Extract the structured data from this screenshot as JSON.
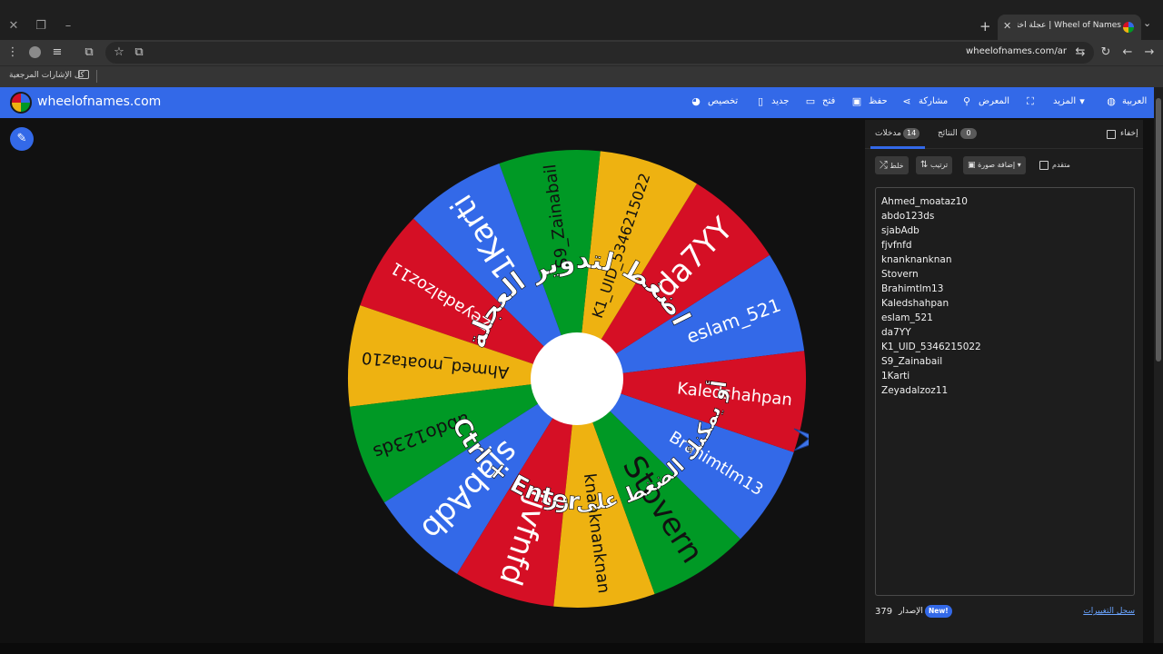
{
  "browser": {
    "tab_title": "Wheel of Names | عجلة اختيار الاسم العشوائي",
    "url": "wheelofnames.com/ar",
    "bookmarks_label": "كل الإشارات المرجعية"
  },
  "appbar": {
    "brand": "wheelofnames.com",
    "customize": "تخصيص",
    "new": "جديد",
    "open": "فتح",
    "save": "حفظ",
    "share": "مشاركة",
    "gallery": "المعرض",
    "more": "المزيد",
    "language": "العربية"
  },
  "wheel": {
    "colors": [
      "#3369e8",
      "#d50f25",
      "#eeb211",
      "#009925"
    ],
    "segments": [
      "eslam_521",
      "da7YY",
      "K1_UID_5346215022",
      "S9_Zainabail",
      "1Karti",
      "Zeyadalzoz11",
      "Ahmed_moataz10",
      "abdo123ds",
      "sjabAdb",
      "fjvfnfd",
      "knanknanknan",
      "Stovern",
      "Brahimtlm13",
      "Kaledshahpan"
    ],
    "overlay_top": "اضغط لتدوير العجلة",
    "overlay_bottom_1": "أو يمكنك الضغط على زر",
    "overlay_bottom_2": "Ctrl + Enter"
  },
  "panel": {
    "tab_entries": "مدخلات",
    "entries_count": "14",
    "tab_results": "النتائج",
    "results_count": "0",
    "hide": "إخفاء",
    "shuffle": "خلط",
    "sort": "ترتيب",
    "add_image": "إضافة صورة",
    "advanced": "متقدم",
    "entries": [
      "Ahmed_moataz10",
      "abdo123ds",
      "sjabAdb",
      "fjvfnfd",
      "knanknanknan",
      "Stovern",
      "Brahimtlm13",
      "Kaledshahpan",
      "eslam_521",
      "da7YY",
      "K1_UID_5346215022",
      "S9_Zainabail",
      "1Karti",
      "Zeyadalzoz11"
    ],
    "version_label": "الإصدار",
    "version_number": "379",
    "new_badge": "New!",
    "changelog": "سجل التغييرات"
  }
}
